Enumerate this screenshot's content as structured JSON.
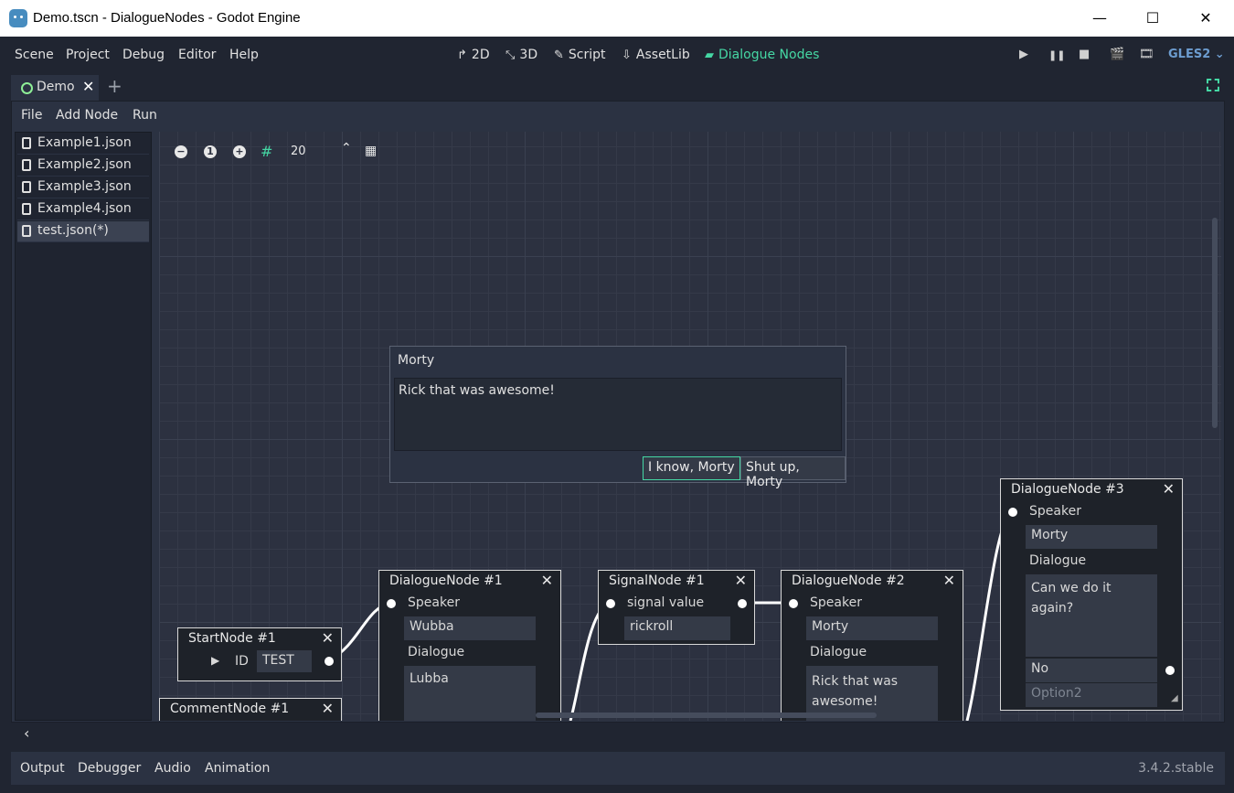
{
  "window": {
    "title": "Demo.tscn - DialogueNodes - Godot Engine",
    "minimize": "—",
    "maximize": "☐",
    "close": "✕"
  },
  "menu": [
    "Scene",
    "Project",
    "Debug",
    "Editor",
    "Help"
  ],
  "workspaces": [
    {
      "icon": "↱",
      "label": "2D"
    },
    {
      "icon": "⤡",
      "label": "3D"
    },
    {
      "icon": "✎",
      "label": "Script"
    },
    {
      "icon": "⇩",
      "label": "AssetLib"
    },
    {
      "icon": "▰",
      "label": "Dialogue Nodes"
    }
  ],
  "run_controls": {
    "play": "▶",
    "pause": "❚❚",
    "stop": "■",
    "renderer": "GLES2 ⌄"
  },
  "scene_tab": {
    "label": "Demo",
    "close": "✕",
    "add": "+"
  },
  "plugin_menu": [
    "File",
    "Add Node",
    "Run"
  ],
  "files": [
    "Example1.json",
    "Example2.json",
    "Example3.json",
    "Example4.json",
    "test.json(*)"
  ],
  "graph_toolbar": {
    "zoom_out": "−",
    "zoom_reset": "1",
    "zoom_in": "+",
    "snap_value": "20"
  },
  "preview": {
    "speaker": "Morty",
    "text": "Rick that was awesome!",
    "options": [
      "I know, Morty",
      "Shut up, Morty"
    ]
  },
  "nodes": {
    "start": {
      "title": "StartNode #1",
      "id_label": "ID",
      "id_value": "TEST"
    },
    "comment": {
      "title": "CommentNode #1"
    },
    "dialogue1": {
      "title": "DialogueNode #1",
      "speaker_label": "Speaker",
      "speaker": "Wubba",
      "dialogue_label": "Dialogue",
      "dialogue": "Lubba"
    },
    "signal1": {
      "title": "SignalNode #1",
      "label": "signal value",
      "value": "rickroll"
    },
    "dialogue2": {
      "title": "DialogueNode #2",
      "speaker_label": "Speaker",
      "speaker": "Morty",
      "dialogue_label": "Dialogue",
      "dialogue_line1": "Rick that was",
      "dialogue_line2": "awesome!"
    },
    "dialogue3": {
      "title": "DialogueNode #3",
      "speaker_label": "Speaker",
      "speaker": "Morty",
      "dialogue_label": "Dialogue",
      "dialogue_line1": "Can we do it",
      "dialogue_line2": "again?",
      "option1": "No",
      "option2_placeholder": "Option2"
    }
  },
  "bottom_tabs": [
    "Output",
    "Debugger",
    "Audio",
    "Animation"
  ],
  "version": "3.4.2.stable",
  "colors": {
    "accent": "#45d7a4",
    "background": "#202531",
    "panel": "#2b3242",
    "node_bg": "#1e2229"
  }
}
